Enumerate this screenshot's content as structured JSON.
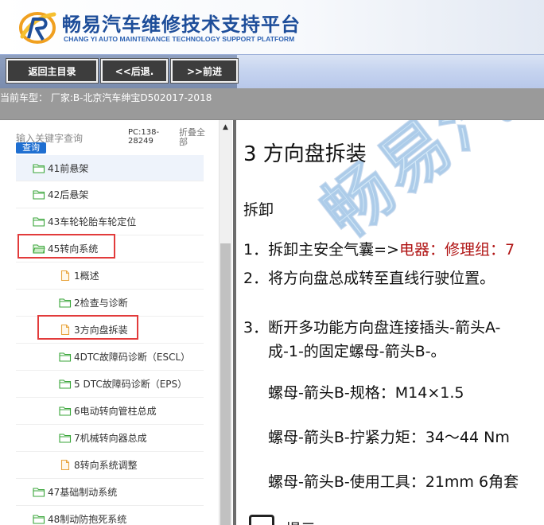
{
  "header": {
    "title": "畅易汽车维修技术支持平台",
    "subtitle": "CHANG YI AUTO MAINTENANCE TECHNOLOGY SUPPORT PLATFORM",
    "logo_icon": "cy-logo-icon"
  },
  "toolbar": {
    "home_label": "返回主目录",
    "back_label": "<<后退.",
    "forward_label": ">>前进"
  },
  "model_bar": {
    "text": "当前车型： 厂家:B-北京汽车绅宝D502017-2018"
  },
  "sidebar": {
    "search_hint": "输入关键字查询",
    "search_button": "查询",
    "pc_code": "PC:138-28249",
    "collapse_all": "折叠全部",
    "items": [
      {
        "label": "41前悬架",
        "type": "folder",
        "level": 1
      },
      {
        "label": "42后悬架",
        "type": "folder",
        "level": 1
      },
      {
        "label": "43车轮轮胎车轮定位",
        "type": "folder",
        "level": 1
      },
      {
        "label": "45转向系统",
        "type": "folder-open",
        "level": 1,
        "highlighted": true
      },
      {
        "label": "1概述",
        "type": "document",
        "level": 2
      },
      {
        "label": "2检查与诊断",
        "type": "folder",
        "level": 2
      },
      {
        "label": "3方向盘拆装",
        "type": "document",
        "level": 2,
        "highlighted": true,
        "selected": true
      },
      {
        "label": "4DTC故障码诊断（ESCL）",
        "type": "folder",
        "level": 2
      },
      {
        "label": "5 DTC故障码诊断（EPS）",
        "type": "folder",
        "level": 2
      },
      {
        "label": "6电动转向管柱总成",
        "type": "folder",
        "level": 2
      },
      {
        "label": "7机械转向器总成",
        "type": "folder",
        "level": 2
      },
      {
        "label": "8转向系统调整",
        "type": "document",
        "level": 2
      },
      {
        "label": "47基础制动系统",
        "type": "folder",
        "level": 1
      },
      {
        "label": "48制动防抱死系统",
        "type": "folder",
        "level": 1
      }
    ]
  },
  "content": {
    "watermark": "畅易汽",
    "title": "3 方向盘拆装",
    "section_remove": "拆卸",
    "step1_prefix": "1．拆卸主安全气囊=>",
    "step1_link": "电器：修理组：7",
    "step2": "2．将方向盘总成转至直线行驶位置。",
    "step3_line1": "3．断开多功能方向盘连接插头-箭头A-",
    "step3_line2": "成-1-的固定螺母-箭头B-。",
    "spec1": "螺母-箭头B-规格：M14×1.5",
    "spec2": "螺母-箭头B-拧紧力矩：34～44 Nm",
    "spec3": "螺母-箭头B-使用工具：21mm 6角套",
    "note_label": "提示"
  },
  "colors": {
    "brand_blue": "#1e4e9a",
    "highlight_red": "#e23b3b",
    "link_red": "#b01414",
    "folder_green": "#3aa63a",
    "doc_orange": "#e8a33c"
  }
}
